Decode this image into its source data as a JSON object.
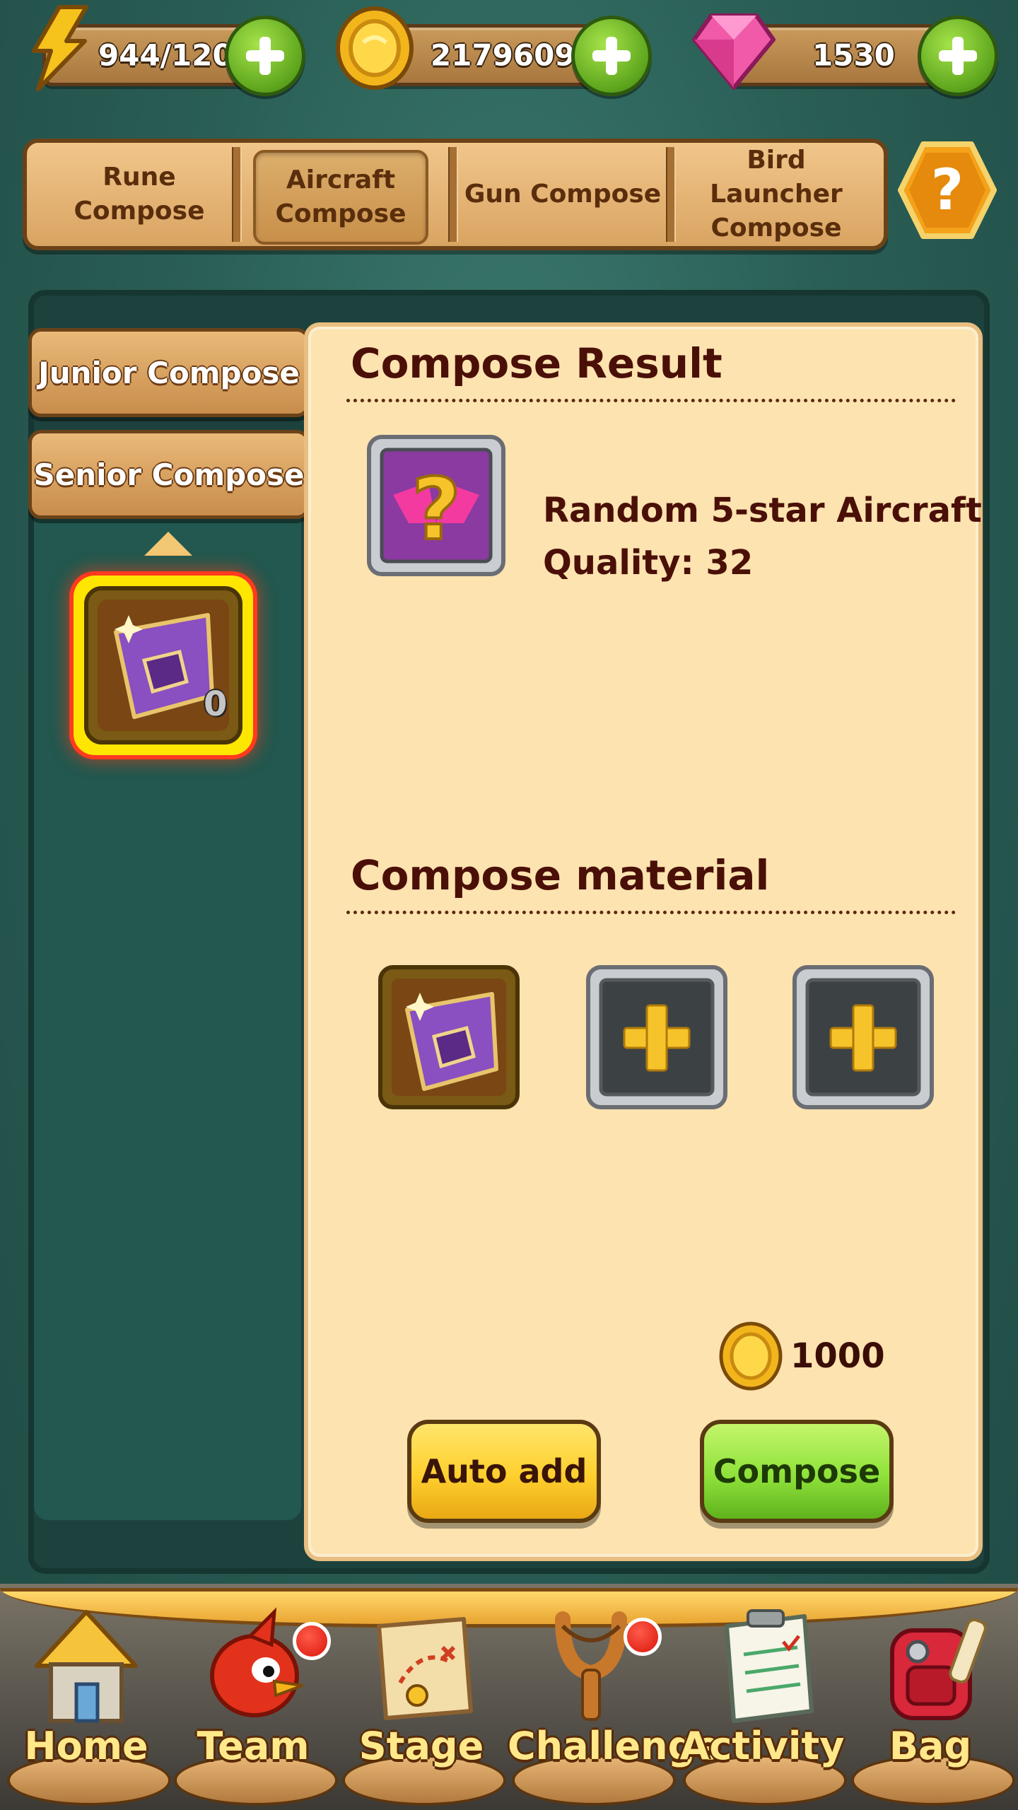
{
  "resources": {
    "energy": "944/120",
    "coins": "2179609",
    "gems": "1530"
  },
  "tabs": [
    {
      "line1": "Rune",
      "line2": "Compose",
      "active": false
    },
    {
      "line1": "Aircraft",
      "line2": "Compose",
      "active": true
    },
    {
      "line1": "Gun Compose",
      "line2": "",
      "active": false
    },
    {
      "line1": "Bird Launcher",
      "line2": "Compose",
      "active": false
    }
  ],
  "sidebar": {
    "junior_label": "Junior Compose",
    "senior_label": "Senior Compose",
    "item_count": "0"
  },
  "result": {
    "title": "Compose Result",
    "name": "Random 5-star Aircraft",
    "quality": "Quality: 32"
  },
  "material": {
    "title": "Compose material"
  },
  "cost": {
    "amount": "1000"
  },
  "buttons": {
    "auto_add": "Auto add",
    "compose": "Compose"
  },
  "nav": [
    {
      "label": "Home",
      "badge": false
    },
    {
      "label": "Team",
      "badge": true
    },
    {
      "label": "Stage",
      "badge": false
    },
    {
      "label": "Challenge",
      "badge": true
    },
    {
      "label": "Activity",
      "badge": false
    },
    {
      "label": "Bag",
      "badge": false
    }
  ],
  "colors": {
    "background": "#2a5f56",
    "parchment": "#fde3b0",
    "title_text": "#4a1008",
    "compose_button": "#8fe23a",
    "auto_add_button": "#ffcf2e"
  }
}
